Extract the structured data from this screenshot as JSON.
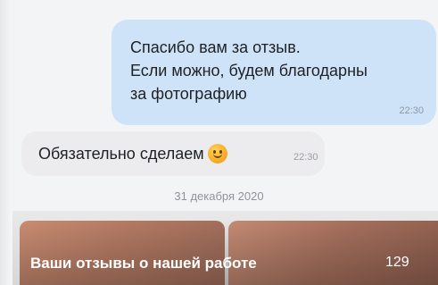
{
  "messages": {
    "outgoing": {
      "lines": [
        "Спасибо вам за отзыв.",
        "Если можно, будем благодарны",
        "за фотографию"
      ],
      "time": "22:30"
    },
    "incoming": {
      "text": "Обязательно сделаем",
      "emoji": "smiling-face-emoji",
      "time": "22:30"
    }
  },
  "date_separator": "31 декабря 2020",
  "album_preview": {
    "title": "Ваши отзывы о нашей работе",
    "count": "129"
  }
}
